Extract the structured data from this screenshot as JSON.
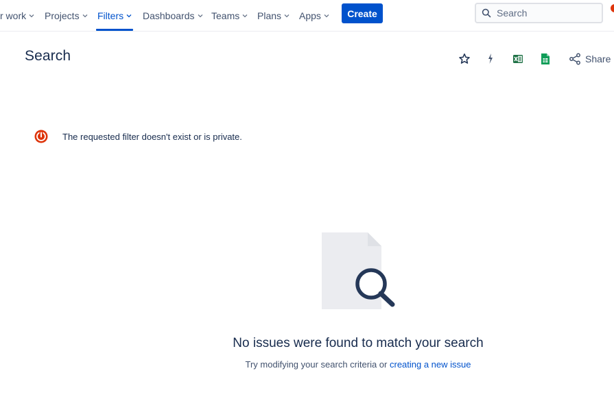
{
  "topnav": {
    "items": [
      {
        "label": "r work",
        "active": false
      },
      {
        "label": "Projects",
        "active": false
      },
      {
        "label": "Filters",
        "active": true
      },
      {
        "label": "Dashboards",
        "active": false
      },
      {
        "label": "Teams",
        "active": false
      },
      {
        "label": "Plans",
        "active": false
      },
      {
        "label": "Apps",
        "active": false
      }
    ],
    "create_label": "Create",
    "search_placeholder": "Search",
    "accent_color": "#0052cc"
  },
  "header": {
    "title": "Search",
    "actions": {
      "star_icon": "star-icon",
      "automation_icon": "lightning-icon",
      "excel_icon": "excel-export-icon",
      "sheets_icon": "google-sheets-icon",
      "share_label": "Share"
    }
  },
  "error": {
    "icon": "error-power-icon",
    "message": "The requested filter doesn't exist or is private.",
    "color": "#de350b"
  },
  "empty_state": {
    "illustration": "document-search-illustration",
    "title": "No issues were found to match your search",
    "subtitle_prefix": "Try modifying your search criteria or ",
    "subtitle_link": "creating a new issue"
  }
}
